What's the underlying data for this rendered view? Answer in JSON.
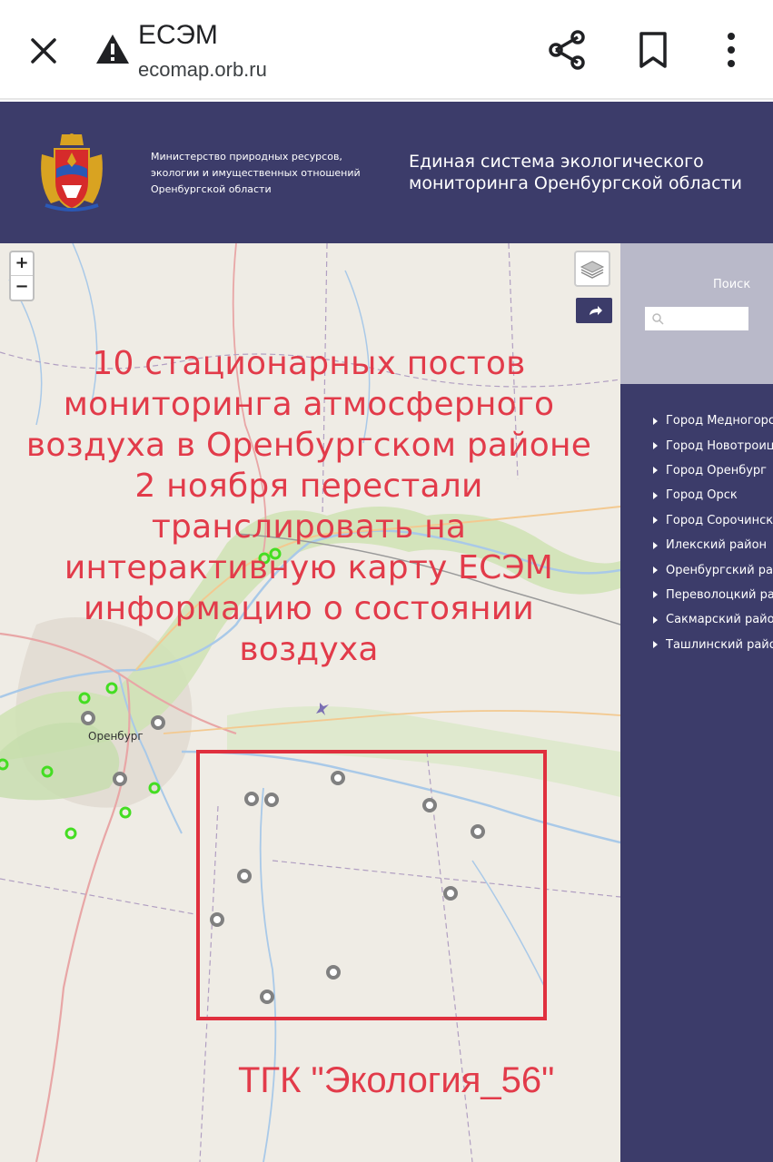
{
  "browser": {
    "title": "ЕСЭМ",
    "url": "ecomap.orb.ru",
    "icons": [
      "close-icon",
      "warning-icon",
      "share-icon",
      "bookmark-icon",
      "more-vert-icon"
    ]
  },
  "header": {
    "ministry_lines": [
      "Министерство природных ресурсов,",
      "экологии и имущественных отношений",
      "Оренбургской области"
    ],
    "system_lines": [
      "Единая система экологического",
      "мониторинга Оренбургской области"
    ],
    "crest_icon": "coat-of-arms-icon",
    "background_color": "#3c3c6a"
  },
  "map": {
    "zoom_in": "+",
    "zoom_out": "−",
    "layers_icon": "layers-icon",
    "share_icon": "arrow-share-icon",
    "city_label": "Оренбург",
    "overlay_lines": [
      "10 стационарных постов",
      "мониторинга атмосферного",
      "воздуха в Оренбургском районе",
      "2 ноября перестали",
      "транслировать на",
      "интерактивную карту ЕСЭМ",
      "информацию о состоянии",
      "воздуха"
    ],
    "watermark": "ТГК \"Экология_56\"",
    "active_station_color": "#44dd22",
    "inactive_station_color": "#808080",
    "highlight_color": "#e0303e"
  },
  "sidebar": {
    "search_label": "Поиск",
    "search_placeholder": "",
    "regions": [
      "Город Медногорск",
      "Город Новотроицк",
      "Город Оренбург",
      "Город Орск",
      "Город Сорочинск",
      "Илекский район",
      "Оренбургский район",
      "Переволоцкий район",
      "Сакмарский район",
      "Ташлинский район"
    ]
  }
}
